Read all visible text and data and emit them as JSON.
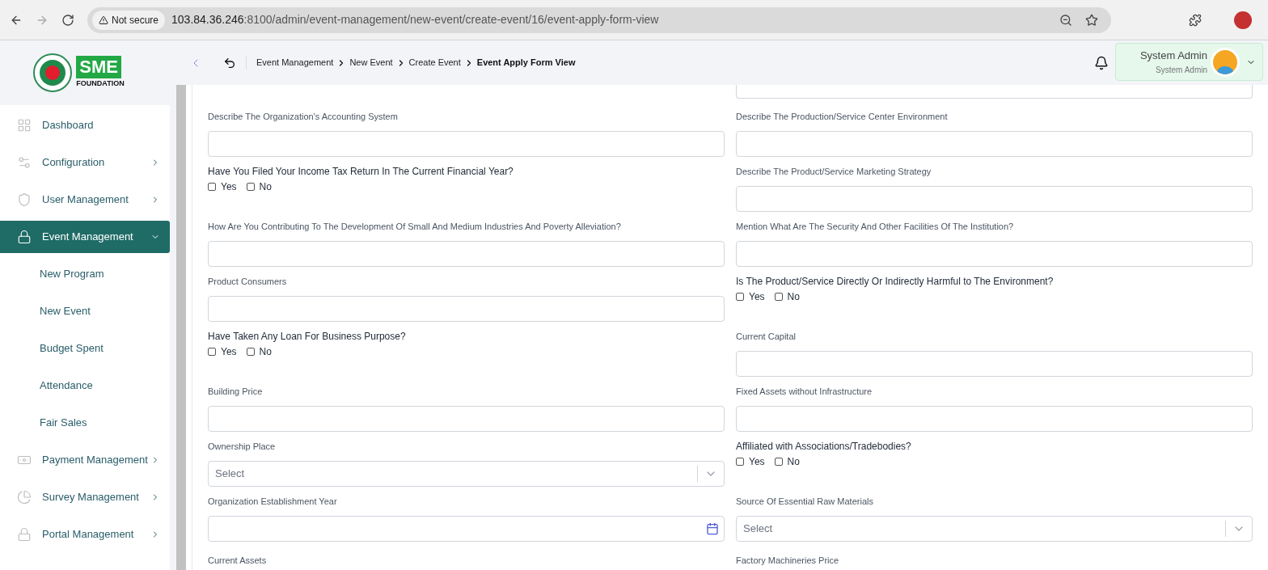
{
  "browser": {
    "security": "Not secure",
    "url_host": "103.84.36.246",
    "url_path": ":8100/admin/event-management/new-event/create-event/16/event-apply-form-view"
  },
  "logo": {
    "mark": "SME",
    "caption": "FOUNDATION"
  },
  "sidebar": {
    "items": [
      {
        "label": "Dashboard",
        "kind": "link",
        "selected": false
      },
      {
        "label": "Configuration",
        "kind": "group",
        "selected": false,
        "expanded": false
      },
      {
        "label": "User Management",
        "kind": "group",
        "selected": false,
        "expanded": false
      },
      {
        "label": "Event Management",
        "kind": "group",
        "selected": true,
        "expanded": true,
        "children": [
          {
            "label": "New Program",
            "selected": false
          },
          {
            "label": "New Event",
            "selected": false
          },
          {
            "label": "Budget Spent",
            "selected": false
          },
          {
            "label": "Attendance",
            "selected": false
          },
          {
            "label": "Fair Sales",
            "selected": false
          }
        ]
      },
      {
        "label": "Payment Management",
        "kind": "group",
        "selected": false,
        "expanded": false
      },
      {
        "label": "Survey Management",
        "kind": "group",
        "selected": false,
        "expanded": false
      },
      {
        "label": "Portal Management",
        "kind": "group",
        "selected": false,
        "expanded": false
      }
    ]
  },
  "breadcrumbs": [
    "Event Management",
    "New Event",
    "Create Event",
    "Event Apply Form View"
  ],
  "user": {
    "name": "System Admin",
    "role": "System Admin"
  },
  "form": {
    "fields": [
      {
        "kind": "text",
        "label": "Describe The Organization's Accounting System"
      },
      {
        "kind": "text",
        "label": "Describe The Production/Service Center Environment"
      },
      {
        "kind": "yesno",
        "label": "Have You Filed Your Income Tax Return In The Current Financial Year?",
        "options": [
          {
            "label": "Yes",
            "checked": false
          },
          {
            "label": "No",
            "checked": false
          }
        ]
      },
      {
        "kind": "text",
        "label": "Describe The Product/Service Marketing Strategy"
      },
      {
        "kind": "text",
        "label": "How Are You Contributing To The Development Of Small And Medium Industries And Poverty Alleviation?"
      },
      {
        "kind": "text",
        "label": "Mention What Are The Security And Other Facilities Of The Institution?"
      },
      {
        "kind": "text",
        "label": "Product Consumers"
      },
      {
        "kind": "yesno",
        "label": "Is The Product/Service Directly Or Indirectly Harmful to The Environment?",
        "options": [
          {
            "label": "Yes",
            "checked": false
          },
          {
            "label": "No",
            "checked": false
          }
        ]
      },
      {
        "kind": "yesno",
        "label": "Have Taken Any Loan For Business Purpose?",
        "options": [
          {
            "label": "Yes",
            "checked": false
          },
          {
            "label": "No",
            "checked": false
          }
        ]
      },
      {
        "kind": "text",
        "label": "Current Capital"
      },
      {
        "kind": "text",
        "label": "Building Price"
      },
      {
        "kind": "text",
        "label": "Fixed Assets without Infrastructure"
      },
      {
        "kind": "select",
        "label": "Ownership Place",
        "placeholder": "Select"
      },
      {
        "kind": "yesno",
        "label": "Affiliated with Associations/Tradebodies?",
        "options": [
          {
            "label": "Yes",
            "checked": false
          },
          {
            "label": "No",
            "checked": false
          }
        ]
      },
      {
        "kind": "date",
        "label": "Organization Establishment Year"
      },
      {
        "kind": "select",
        "label": "Source Of Essential Raw Materials",
        "placeholder": "Select"
      },
      {
        "kind": "heading",
        "label": "Current Assets"
      },
      {
        "kind": "heading",
        "label": "Factory Machineries Price"
      }
    ]
  }
}
